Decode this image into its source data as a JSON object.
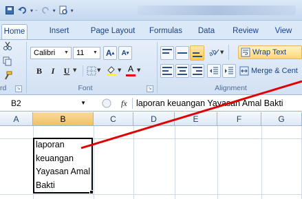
{
  "quick_access": {
    "icons": [
      "save-icon",
      "undo-icon",
      "redo-icon",
      "print-preview-icon",
      "customize-icon"
    ]
  },
  "tabs": [
    {
      "label": "Home",
      "active": true
    },
    {
      "label": "Insert"
    },
    {
      "label": "Page Layout"
    },
    {
      "label": "Formulas"
    },
    {
      "label": "Data"
    },
    {
      "label": "Review"
    },
    {
      "label": "View"
    }
  ],
  "ribbon": {
    "clipboard_label": "rd",
    "font": {
      "name": "Calibri",
      "size": "11",
      "grow": "A",
      "shrink": "A",
      "bold": "B",
      "italic": "I",
      "underline": "U",
      "font_color": "A",
      "label": "Font"
    },
    "alignment": {
      "wrap_text": "Wrap Text",
      "merge": "Merge & Cent",
      "label": "Alignment"
    }
  },
  "formula_bar": {
    "cell_ref": "B2",
    "fx": "fx",
    "content": "laporan keuangan Yayasan Amal Bakti"
  },
  "columns": [
    "A",
    "B",
    "C",
    "D",
    "E",
    "F",
    "G"
  ],
  "selected_column": "B",
  "cell_b2": {
    "lines": [
      "laporan",
      "keuangan",
      "Yayasan Amal",
      "Bakti"
    ]
  },
  "colors": {
    "ribbon_bg": "#dbe8f7",
    "selected_header": "#f1c15f",
    "annotation_arrow": "#e00000"
  }
}
